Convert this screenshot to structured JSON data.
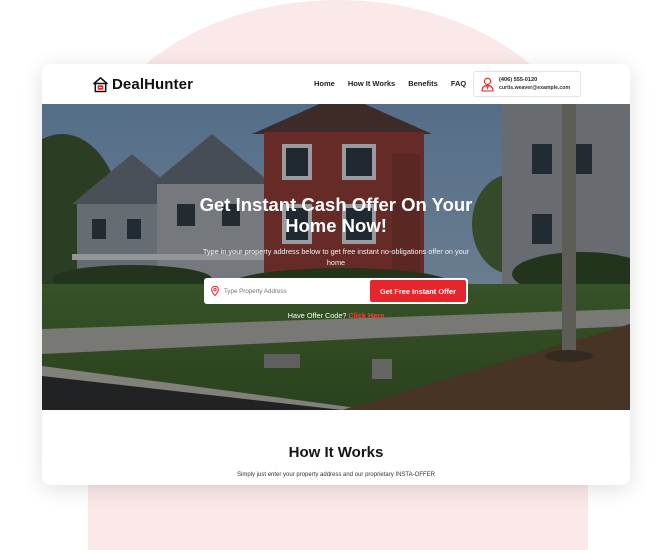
{
  "brand": {
    "name": "DealHunter",
    "accent_color": "#e5262d",
    "logo_icon": "house-icon"
  },
  "nav": {
    "links": [
      "Home",
      "How It Works",
      "Benefits",
      "FAQ"
    ],
    "contact": {
      "icon": "agent-icon",
      "phone": "(406) 555-0120",
      "email": "curtis.weaver@example.com"
    }
  },
  "hero": {
    "title": "Get Instant Cash Offer On Your Home Now!",
    "subtitle": "Type in your property address below to get free instant no-obligations offer on your home",
    "search_placeholder": "Type Property Address",
    "search_icon": "location-pin-icon",
    "cta_label": "Get Free Instant Offer",
    "offer_code_prompt": "Have Offer Code?",
    "offer_code_link": "Click Here"
  },
  "how_it_works": {
    "title": "How It Works",
    "text": "Simply just enter your property address and our proprietary INSTA-OFFER"
  }
}
